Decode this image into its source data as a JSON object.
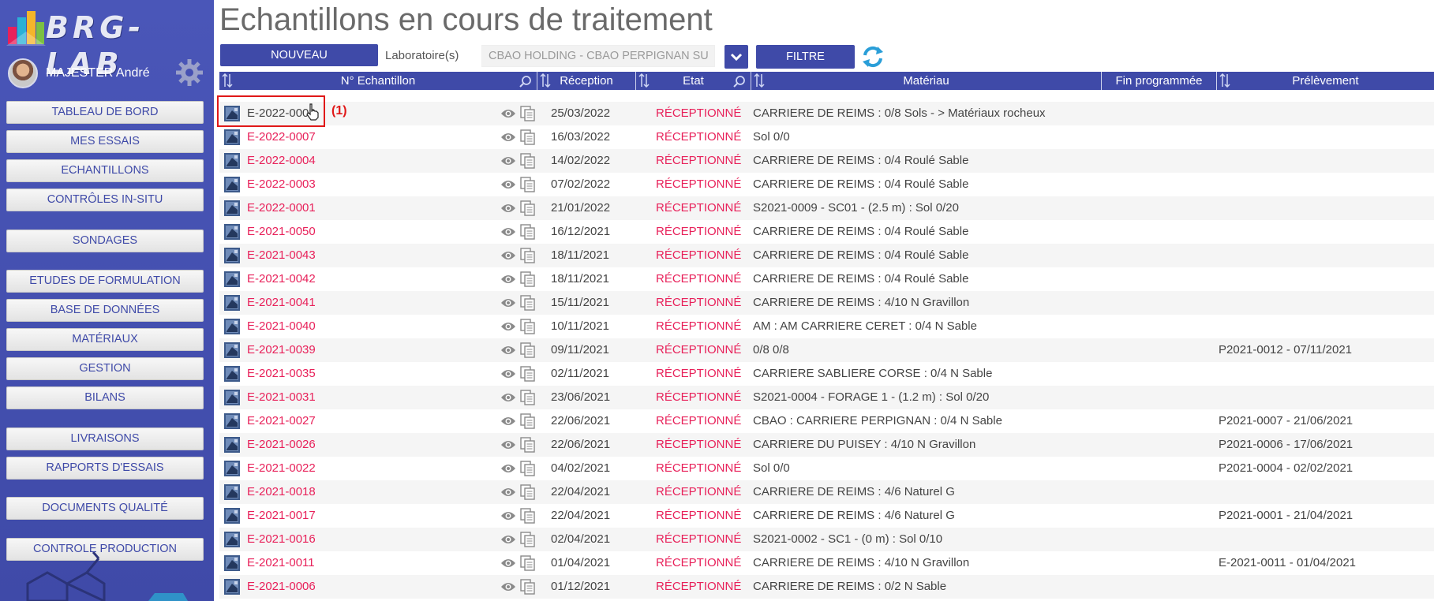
{
  "app": {
    "logo_text": "BRG-LAB"
  },
  "user": {
    "name": "MAJESTER André"
  },
  "sidebar": {
    "nav": [
      "TABLEAU DE BORD",
      "MES ESSAIS",
      "ECHANTILLONS",
      "CONTRÔLES IN-SITU",
      "SONDAGES",
      "ETUDES DE FORMULATION",
      "BASE DE DONNÉES",
      "MATÉRIAUX",
      "GESTION",
      "BILANS",
      "LIVRAISONS",
      "RAPPORTS D'ESSAIS",
      "DOCUMENTS QUALITÉ",
      "CONTROLE PRODUCTION"
    ]
  },
  "page": {
    "title": "Echantillons en cours de traitement"
  },
  "toolbar": {
    "nouveau_label": "NOUVEAU",
    "lab_label": "Laboratoire(s)",
    "lab_value": "CBAO HOLDING - CBAO PERPIGNAN SU",
    "filtre_label": "FILTRE"
  },
  "table": {
    "headers": {
      "echantillon": "N° Echantillon",
      "reception": "Réception",
      "etat": "Etat",
      "materiau": "Matériau",
      "fin": "Fin programmée",
      "prelevement": "Prélèvement"
    },
    "rows": [
      {
        "id": "E-2022-0008",
        "reception": "25/03/2022",
        "etat": "RÉCEPTIONNÉ",
        "materiau": "CARRIERE DE REIMS : 0/8 Sols - > Matériaux rocheux",
        "prelevement": ""
      },
      {
        "id": "E-2022-0007",
        "reception": "16/03/2022",
        "etat": "RÉCEPTIONNÉ",
        "materiau": "Sol 0/0",
        "prelevement": ""
      },
      {
        "id": "E-2022-0004",
        "reception": "14/02/2022",
        "etat": "RÉCEPTIONNÉ",
        "materiau": "CARRIERE DE REIMS : 0/4 Roulé Sable",
        "prelevement": ""
      },
      {
        "id": "E-2022-0003",
        "reception": "07/02/2022",
        "etat": "RÉCEPTIONNÉ",
        "materiau": "CARRIERE DE REIMS : 0/4 Roulé Sable",
        "prelevement": ""
      },
      {
        "id": "E-2022-0001",
        "reception": "21/01/2022",
        "etat": "RÉCEPTIONNÉ",
        "materiau": "S2021-0009 - SC01 - (2.5 m) : Sol 0/20",
        "prelevement": ""
      },
      {
        "id": "E-2021-0050",
        "reception": "16/12/2021",
        "etat": "RÉCEPTIONNÉ",
        "materiau": "CARRIERE DE REIMS : 0/4 Roulé Sable",
        "prelevement": ""
      },
      {
        "id": "E-2021-0043",
        "reception": "18/11/2021",
        "etat": "RÉCEPTIONNÉ",
        "materiau": "CARRIERE DE REIMS : 0/4 Roulé Sable",
        "prelevement": ""
      },
      {
        "id": "E-2021-0042",
        "reception": "18/11/2021",
        "etat": "RÉCEPTIONNÉ",
        "materiau": "CARRIERE DE REIMS : 0/4 Roulé Sable",
        "prelevement": ""
      },
      {
        "id": "E-2021-0041",
        "reception": "15/11/2021",
        "etat": "RÉCEPTIONNÉ",
        "materiau": "CARRIERE DE REIMS : 4/10 N Gravillon",
        "prelevement": ""
      },
      {
        "id": "E-2021-0040",
        "reception": "10/11/2021",
        "etat": "RÉCEPTIONNÉ",
        "materiau": "AM : AM CARRIERE CERET : 0/4 N Sable",
        "prelevement": ""
      },
      {
        "id": "E-2021-0039",
        "reception": "09/11/2021",
        "etat": "RÉCEPTIONNÉ",
        "materiau": "0/8 0/8",
        "prelevement": "P2021-0012 - 07/11/2021"
      },
      {
        "id": "E-2021-0035",
        "reception": "02/11/2021",
        "etat": "RÉCEPTIONNÉ",
        "materiau": "CARRIERE SABLIERE CORSE : 0/4 N Sable",
        "prelevement": ""
      },
      {
        "id": "E-2021-0031",
        "reception": "23/06/2021",
        "etat": "RÉCEPTIONNÉ",
        "materiau": "S2021-0004 - FORAGE 1 - (1.2 m) : Sol 0/20",
        "prelevement": ""
      },
      {
        "id": "E-2021-0027",
        "reception": "22/06/2021",
        "etat": "RÉCEPTIONNÉ",
        "materiau": "CBAO : CARRIERE PERPIGNAN : 0/4 N Sable",
        "prelevement": "P2021-0007 - 21/06/2021"
      },
      {
        "id": "E-2021-0026",
        "reception": "22/06/2021",
        "etat": "RÉCEPTIONNÉ",
        "materiau": "CARRIERE DU PUISEY : 4/10 N Gravillon",
        "prelevement": "P2021-0006 - 17/06/2021"
      },
      {
        "id": "E-2021-0022",
        "reception": "04/02/2021",
        "etat": "RÉCEPTIONNÉ",
        "materiau": "Sol 0/0",
        "prelevement": "P2021-0004 - 02/02/2021"
      },
      {
        "id": "E-2021-0018",
        "reception": "22/04/2021",
        "etat": "RÉCEPTIONNÉ",
        "materiau": "CARRIERE DE REIMS : 4/6 Naturel G",
        "prelevement": ""
      },
      {
        "id": "E-2021-0017",
        "reception": "22/04/2021",
        "etat": "RÉCEPTIONNÉ",
        "materiau": "CARRIERE DE REIMS : 4/6 Naturel G",
        "prelevement": "P2021-0001 - 21/04/2021"
      },
      {
        "id": "E-2021-0016",
        "reception": "02/04/2021",
        "etat": "RÉCEPTIONNÉ",
        "materiau": "S2021-0002 - SC1 - (0 m) : Sol 0/10",
        "prelevement": ""
      },
      {
        "id": "E-2021-0011",
        "reception": "01/04/2021",
        "etat": "RÉCEPTIONNÉ",
        "materiau": "CARRIERE DE REIMS : 4/10 N Gravillon",
        "prelevement": "E-2021-0011 - 01/04/2021"
      },
      {
        "id": "E-2021-0006",
        "reception": "01/12/2021",
        "etat": "RÉCEPTIONNÉ",
        "materiau": "CARRIERE DE REIMS : 0/2 N Sable",
        "prelevement": ""
      }
    ]
  },
  "annotation": {
    "label": "(1)"
  },
  "colors": {
    "primary": "#3f4aa8",
    "accent": "#e8215a",
    "highlight": "#e01818"
  }
}
